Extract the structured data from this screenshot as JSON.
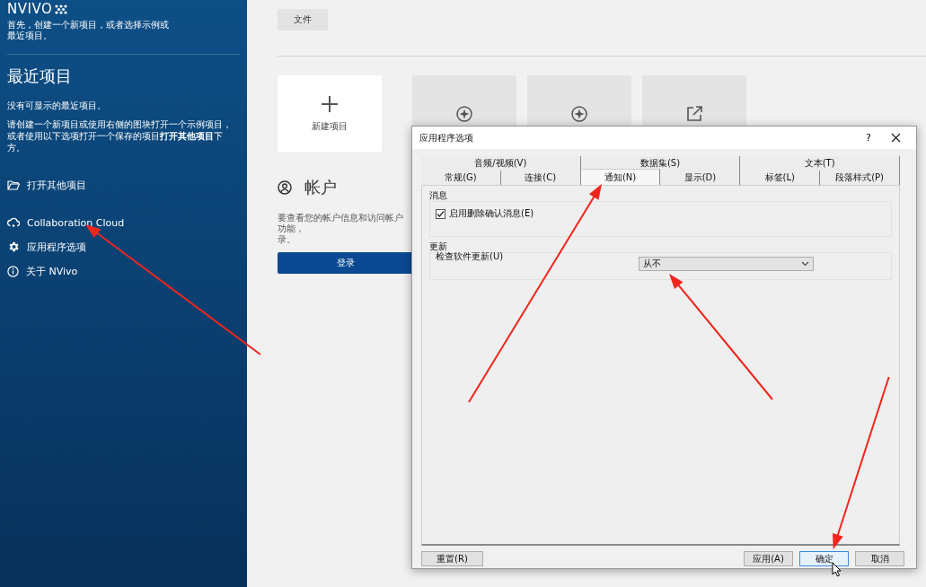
{
  "sidebar": {
    "logo": "NVIVO",
    "intro": "首先，创建一个新项目，或者选择示例或最近项目。",
    "heading": "最近项目",
    "empty_note": "没有可显示的最近项目。",
    "hint": "请创建一个新项目或使用右侧的图块打开一个示例项目，或者使用以下选项打开一个保存的项目**打开其他项目**下方。",
    "open_item": "打开其他项目",
    "items": [
      {
        "label": "Collaboration Cloud"
      },
      {
        "label": "应用程序选项"
      },
      {
        "label": "关于 NVivo"
      }
    ]
  },
  "main": {
    "file_button": "文件",
    "tiles": [
      {
        "label": "新建项目",
        "kind": "new"
      },
      {
        "kind": "sample"
      },
      {
        "kind": "sample"
      },
      {
        "kind": "more"
      }
    ],
    "account": {
      "title": "帐户",
      "text_lines": [
        "要查看您的帐户信息和访问帐户功能，",
        "录。"
      ],
      "login_button": "登录"
    }
  },
  "dialog": {
    "title": "应用程序选项",
    "help": "?",
    "tabs_back_row": [
      {
        "label": "音频/视频(V)",
        "selected": false
      },
      {
        "label": "数据集(S)",
        "selected": false
      },
      {
        "label": "文本(T)",
        "selected": false
      }
    ],
    "tabs_front_row": [
      {
        "label": "常规(G)",
        "selected": false
      },
      {
        "label": "连接(C)",
        "selected": false
      },
      {
        "label": "通知(N)",
        "selected": true
      },
      {
        "label": "显示(D)",
        "selected": false
      },
      {
        "label": "标签(L)",
        "selected": false
      },
      {
        "label": "段落样式(P)",
        "selected": false
      }
    ],
    "messages_group": {
      "title": "消息",
      "checkbox": {
        "label": "启用删除确认消息(E)",
        "checked": true
      }
    },
    "update_group": {
      "title": "更新",
      "label": "检查软件更新(U)",
      "select_value": "从不"
    },
    "reset_button": "重置(R)",
    "buttons": [
      {
        "label": "应用(A)",
        "focused": false
      },
      {
        "label": "确定",
        "focused": true
      },
      {
        "label": "取消",
        "focused": false
      }
    ]
  }
}
